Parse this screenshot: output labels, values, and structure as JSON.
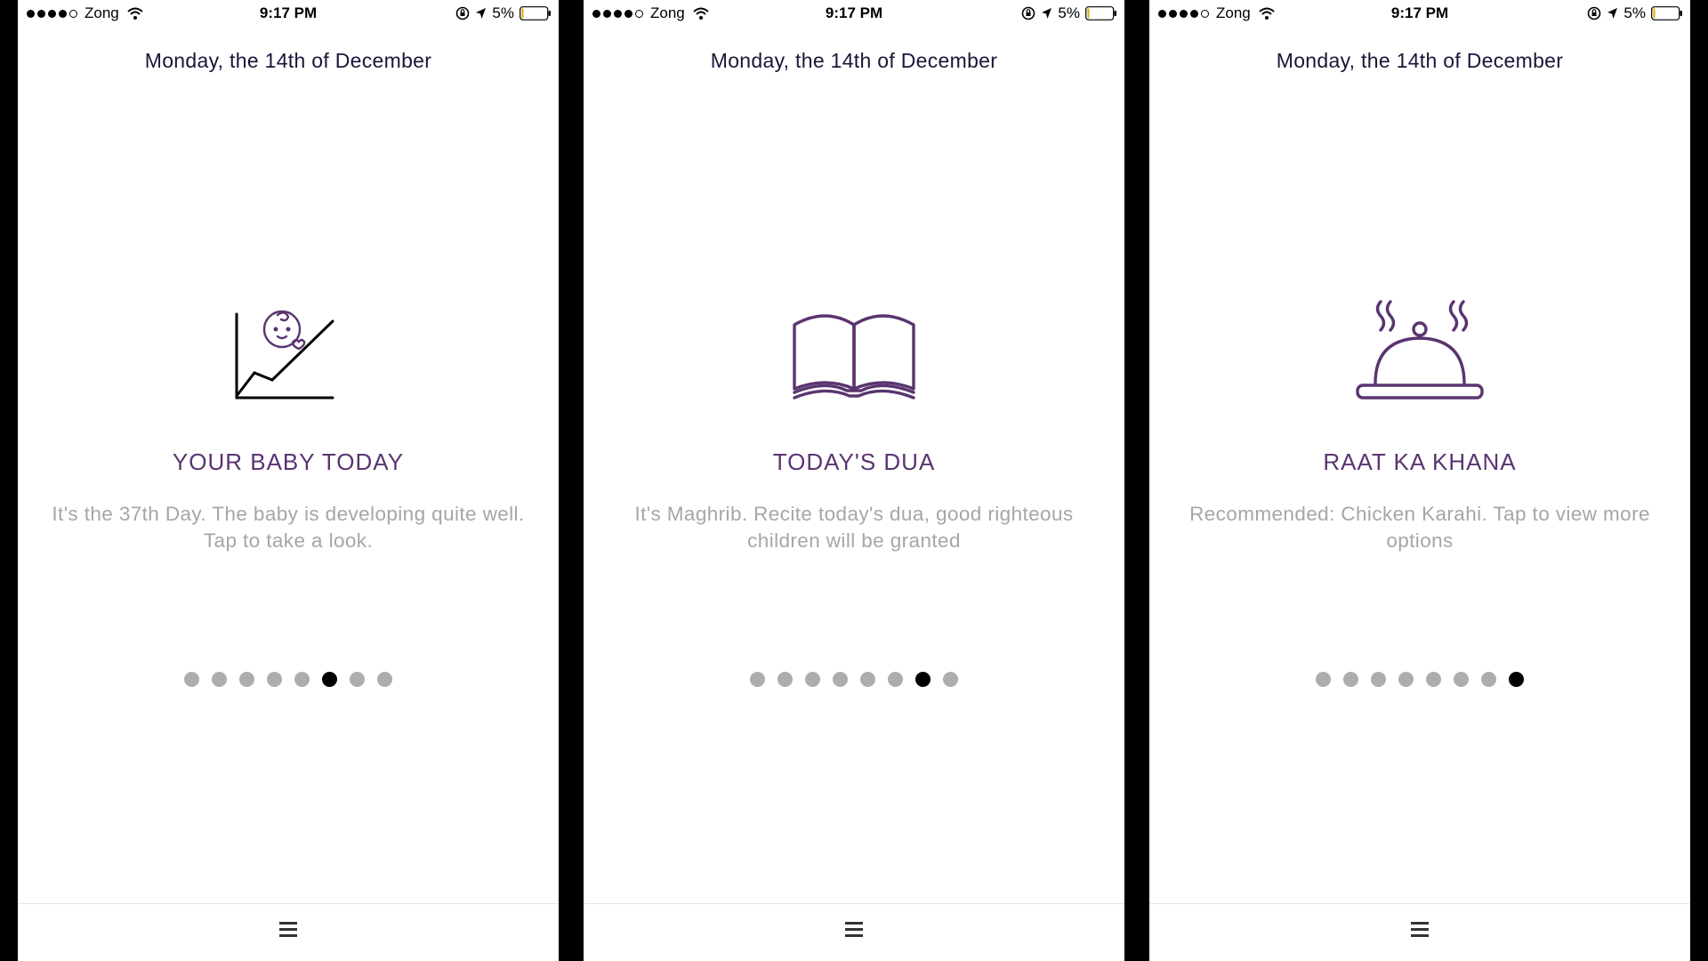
{
  "status_bar": {
    "carrier": "Zong",
    "time": "9:17 PM",
    "battery": "5%",
    "signal_filled": 4,
    "signal_total": 5
  },
  "date_header": "Monday, the 14th of December",
  "screens": [
    {
      "icon": "baby-growth-chart-icon",
      "title": "YOUR BABY TODAY",
      "description": "It's the 37th Day. The baby is developing quite well. Tap to take a look.",
      "active_page": 6,
      "page_count": 8
    },
    {
      "icon": "open-book-icon",
      "title": "TODAY'S DUA",
      "description": "It's Maghrib. Recite today's dua, good righteous children will be granted",
      "active_page": 7,
      "page_count": 8
    },
    {
      "icon": "food-cloche-icon",
      "title": "RAAT KA KHANA",
      "description": "Recommended: Chicken Karahi. Tap to view more options",
      "active_page": 8,
      "page_count": 8
    }
  ],
  "colors": {
    "accent": "#5a3470",
    "date_text": "#1c1538",
    "description_text": "#a6a6a6",
    "inactive_dot": "#adadad",
    "active_dot": "#000000"
  }
}
